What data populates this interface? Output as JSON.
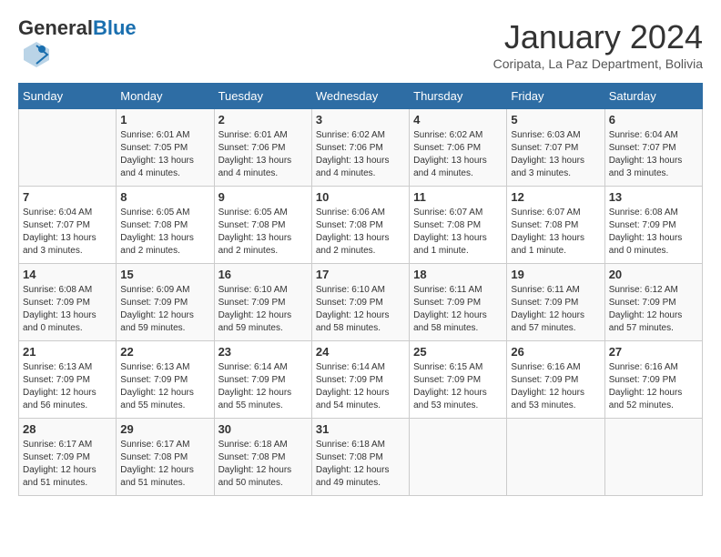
{
  "header": {
    "logo_general": "General",
    "logo_blue": "Blue",
    "month_title": "January 2024",
    "location": "Coripata, La Paz Department, Bolivia"
  },
  "days_of_week": [
    "Sunday",
    "Monday",
    "Tuesday",
    "Wednesday",
    "Thursday",
    "Friday",
    "Saturday"
  ],
  "weeks": [
    [
      {
        "day": "",
        "sunrise": "",
        "sunset": "",
        "daylight": ""
      },
      {
        "day": "1",
        "sunrise": "6:01 AM",
        "sunset": "7:05 PM",
        "daylight": "13 hours and 4 minutes."
      },
      {
        "day": "2",
        "sunrise": "6:01 AM",
        "sunset": "7:06 PM",
        "daylight": "13 hours and 4 minutes."
      },
      {
        "day": "3",
        "sunrise": "6:02 AM",
        "sunset": "7:06 PM",
        "daylight": "13 hours and 4 minutes."
      },
      {
        "day": "4",
        "sunrise": "6:02 AM",
        "sunset": "7:06 PM",
        "daylight": "13 hours and 4 minutes."
      },
      {
        "day": "5",
        "sunrise": "6:03 AM",
        "sunset": "7:07 PM",
        "daylight": "13 hours and 3 minutes."
      },
      {
        "day": "6",
        "sunrise": "6:04 AM",
        "sunset": "7:07 PM",
        "daylight": "13 hours and 3 minutes."
      }
    ],
    [
      {
        "day": "7",
        "sunrise": "6:04 AM",
        "sunset": "7:07 PM",
        "daylight": "13 hours and 3 minutes."
      },
      {
        "day": "8",
        "sunrise": "6:05 AM",
        "sunset": "7:08 PM",
        "daylight": "13 hours and 2 minutes."
      },
      {
        "day": "9",
        "sunrise": "6:05 AM",
        "sunset": "7:08 PM",
        "daylight": "13 hours and 2 minutes."
      },
      {
        "day": "10",
        "sunrise": "6:06 AM",
        "sunset": "7:08 PM",
        "daylight": "13 hours and 2 minutes."
      },
      {
        "day": "11",
        "sunrise": "6:07 AM",
        "sunset": "7:08 PM",
        "daylight": "13 hours and 1 minute."
      },
      {
        "day": "12",
        "sunrise": "6:07 AM",
        "sunset": "7:08 PM",
        "daylight": "13 hours and 1 minute."
      },
      {
        "day": "13",
        "sunrise": "6:08 AM",
        "sunset": "7:09 PM",
        "daylight": "13 hours and 0 minutes."
      }
    ],
    [
      {
        "day": "14",
        "sunrise": "6:08 AM",
        "sunset": "7:09 PM",
        "daylight": "13 hours and 0 minutes."
      },
      {
        "day": "15",
        "sunrise": "6:09 AM",
        "sunset": "7:09 PM",
        "daylight": "12 hours and 59 minutes."
      },
      {
        "day": "16",
        "sunrise": "6:10 AM",
        "sunset": "7:09 PM",
        "daylight": "12 hours and 59 minutes."
      },
      {
        "day": "17",
        "sunrise": "6:10 AM",
        "sunset": "7:09 PM",
        "daylight": "12 hours and 58 minutes."
      },
      {
        "day": "18",
        "sunrise": "6:11 AM",
        "sunset": "7:09 PM",
        "daylight": "12 hours and 58 minutes."
      },
      {
        "day": "19",
        "sunrise": "6:11 AM",
        "sunset": "7:09 PM",
        "daylight": "12 hours and 57 minutes."
      },
      {
        "day": "20",
        "sunrise": "6:12 AM",
        "sunset": "7:09 PM",
        "daylight": "12 hours and 57 minutes."
      }
    ],
    [
      {
        "day": "21",
        "sunrise": "6:13 AM",
        "sunset": "7:09 PM",
        "daylight": "12 hours and 56 minutes."
      },
      {
        "day": "22",
        "sunrise": "6:13 AM",
        "sunset": "7:09 PM",
        "daylight": "12 hours and 55 minutes."
      },
      {
        "day": "23",
        "sunrise": "6:14 AM",
        "sunset": "7:09 PM",
        "daylight": "12 hours and 55 minutes."
      },
      {
        "day": "24",
        "sunrise": "6:14 AM",
        "sunset": "7:09 PM",
        "daylight": "12 hours and 54 minutes."
      },
      {
        "day": "25",
        "sunrise": "6:15 AM",
        "sunset": "7:09 PM",
        "daylight": "12 hours and 53 minutes."
      },
      {
        "day": "26",
        "sunrise": "6:16 AM",
        "sunset": "7:09 PM",
        "daylight": "12 hours and 53 minutes."
      },
      {
        "day": "27",
        "sunrise": "6:16 AM",
        "sunset": "7:09 PM",
        "daylight": "12 hours and 52 minutes."
      }
    ],
    [
      {
        "day": "28",
        "sunrise": "6:17 AM",
        "sunset": "7:09 PM",
        "daylight": "12 hours and 51 minutes."
      },
      {
        "day": "29",
        "sunrise": "6:17 AM",
        "sunset": "7:08 PM",
        "daylight": "12 hours and 51 minutes."
      },
      {
        "day": "30",
        "sunrise": "6:18 AM",
        "sunset": "7:08 PM",
        "daylight": "12 hours and 50 minutes."
      },
      {
        "day": "31",
        "sunrise": "6:18 AM",
        "sunset": "7:08 PM",
        "daylight": "12 hours and 49 minutes."
      },
      {
        "day": "",
        "sunrise": "",
        "sunset": "",
        "daylight": ""
      },
      {
        "day": "",
        "sunrise": "",
        "sunset": "",
        "daylight": ""
      },
      {
        "day": "",
        "sunrise": "",
        "sunset": "",
        "daylight": ""
      }
    ]
  ]
}
